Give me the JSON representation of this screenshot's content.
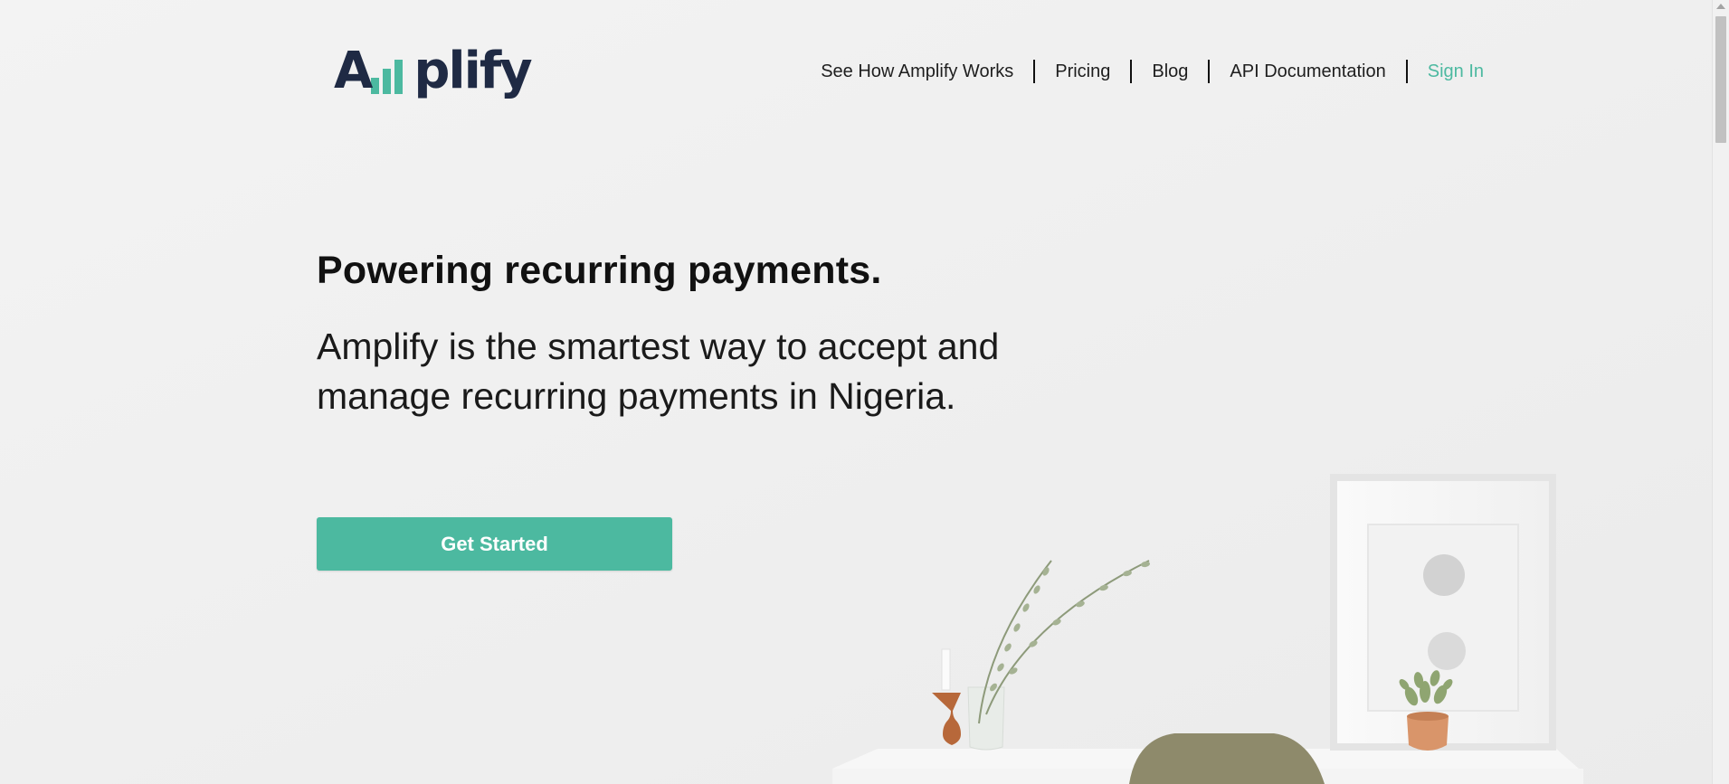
{
  "header": {
    "logo_text": "Amplify",
    "logo_colors": {
      "text": "#1f2a44",
      "bars": "#4cb9a0"
    },
    "nav": [
      {
        "label": "See How Amplify Works"
      },
      {
        "label": "Pricing"
      },
      {
        "label": "Blog"
      },
      {
        "label": "API Documentation"
      },
      {
        "label": "Sign In"
      }
    ]
  },
  "hero": {
    "headline": "Powering recurring payments.",
    "subtext": "Amplify is the smartest way to accept and manage recurring payments in Nigeria.",
    "cta_label": "Get Started"
  },
  "theme": {
    "accent": "#4cb9a0",
    "text_dark": "#111111"
  },
  "icons": {
    "logo_bars": "bar-chart-icon",
    "scroll_up": "arrow-up-icon"
  }
}
